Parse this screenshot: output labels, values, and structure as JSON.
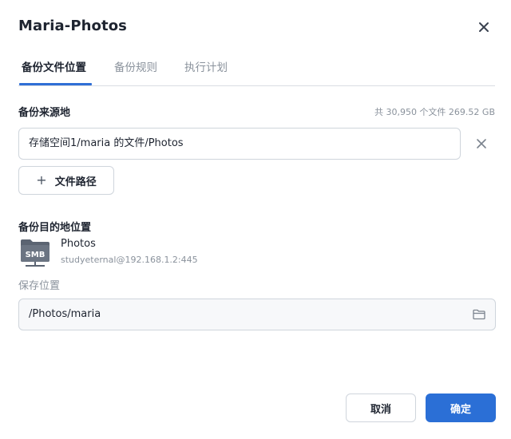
{
  "dialog": {
    "title": "Maria-Photos"
  },
  "tabs": [
    {
      "label": "备份文件位置",
      "active": true
    },
    {
      "label": "备份规则",
      "active": false
    },
    {
      "label": "执行计划",
      "active": false
    }
  ],
  "source": {
    "label": "备份来源地",
    "stats": "共 30,950 个文件 269.52 GB",
    "path": "存储空间1/maria 的文件/Photos",
    "add_path_label": "文件路径"
  },
  "destination": {
    "label": "备份目的地位置",
    "icon_text": "SMB",
    "name": "Photos",
    "host": "studyeternal@192.168.1.2:445",
    "save_label": "保存位置",
    "save_path": "/Photos/maria"
  },
  "footer": {
    "cancel_label": "取消",
    "ok_label": "确定"
  },
  "colors": {
    "accent": "#2b6fd6",
    "muted_text": "#8a929c",
    "smb_icon": "#5b6472"
  },
  "icons": {
    "close": "close-icon",
    "remove": "close-icon",
    "add": "plus-icon",
    "smb": "smb-share-icon",
    "folder": "folder-icon"
  }
}
